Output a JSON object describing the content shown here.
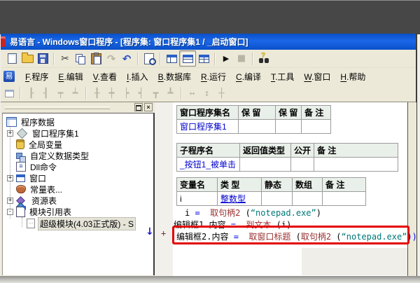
{
  "window": {
    "title": "易语言 - Windows窗口程序 - [程序集: 窗口程序集1 / _启动窗口]"
  },
  "menu": {
    "logo": "易",
    "items": [
      {
        "key": "F",
        "label": ".程序"
      },
      {
        "key": "E",
        "label": ".编辑"
      },
      {
        "key": "V",
        "label": ".查看"
      },
      {
        "key": "I",
        "label": ".插入"
      },
      {
        "key": "B",
        "label": ".数据库"
      },
      {
        "key": "R",
        "label": ".运行"
      },
      {
        "key": "C",
        "label": ".编译"
      },
      {
        "key": "T",
        "label": ".工具"
      },
      {
        "key": "W",
        "label": ".窗口"
      },
      {
        "key": "H",
        "label": ".帮助"
      }
    ]
  },
  "toolbar_main": {
    "icons": [
      "new-file",
      "open-file",
      "save",
      "cut",
      "copy",
      "paste",
      "redo",
      "undo",
      "print-preview",
      "window-layout-1",
      "window-layout-2",
      "window-layout-3",
      "run",
      "stop",
      "find-in-help"
    ],
    "help_mark": "?"
  },
  "toolbar_form": {
    "icons": [
      "form-window",
      "align-left",
      "align-right",
      "align-top",
      "align-bottom",
      "center-horizontal",
      "center-vertical",
      "space-left",
      "space-right",
      "space-top",
      "space-bottom",
      "same-width",
      "same-height",
      "same-size"
    ],
    "glyphs": [
      "┠",
      "┨",
      "┯",
      "┷",
      "╂",
      "┿",
      "┝",
      "┥",
      "┳",
      "┻",
      "↔",
      "↕",
      "┼"
    ]
  },
  "sidebar": {
    "float_button": "float-panel",
    "close_button": "×",
    "tree": [
      {
        "label": "程序数据"
      },
      {
        "label": "窗口程序集1",
        "expander": "+"
      },
      {
        "label": "全局变量"
      },
      {
        "label": "自定义数据类型"
      },
      {
        "label": "Dll命令"
      },
      {
        "label": "窗口",
        "expander": "+"
      },
      {
        "label": "常量表..."
      },
      {
        "label": "资源表",
        "expander": "+"
      },
      {
        "label": "模块引用表",
        "expander": "-"
      },
      {
        "label": "超级模块(4.03正式版) - S",
        "selected": true
      }
    ],
    "dll_icon_glyph": "≡",
    "module_icon_glyph": "…"
  },
  "editor": {
    "tables": [
      {
        "headers": [
          "窗口程序集名",
          "保 留",
          "保 留",
          "备 注"
        ],
        "rows": [
          [
            "窗口程序集1",
            "",
            "",
            ""
          ]
        ]
      },
      {
        "headers": [
          "子程序名",
          "返回值类型",
          "公开",
          "备 注"
        ],
        "rows": [
          [
            "_按钮1_被单击",
            "",
            "",
            ""
          ]
        ]
      },
      {
        "headers": [
          "变量名",
          "类 型",
          "静态",
          "数组",
          "备 注"
        ],
        "rows": [
          [
            "i",
            "整数型",
            "",
            "",
            ""
          ]
        ]
      }
    ],
    "code_lines": [
      {
        "tokens": [
          {
            "t": "i "
          },
          {
            "t": "=",
            "c": "op"
          },
          {
            "t": "  "
          },
          {
            "t": "取句柄2",
            "c": "fn"
          },
          {
            "t": " ("
          },
          {
            "t": "“notepad.exe”",
            "c": "str"
          },
          {
            "t": ")"
          }
        ]
      },
      {
        "tokens": [
          {
            "t": "编辑框1.内容 "
          },
          {
            "t": "=",
            "c": "op"
          },
          {
            "t": "  "
          },
          {
            "t": "到文本",
            "c": "fn"
          },
          {
            "t": " (i)"
          }
        ]
      },
      {
        "tokens": [
          {
            "t": "编辑框2.内容 "
          },
          {
            "t": "=",
            "c": "op"
          },
          {
            "t": "  "
          },
          {
            "t": "取窗口标题",
            "c": "fn"
          },
          {
            "t": " ("
          },
          {
            "t": "取句柄2",
            "c": "fn"
          },
          {
            "t": " ("
          },
          {
            "t": "“notepad.exe”",
            "c": "str"
          },
          {
            "t": "))",
            "c": "op"
          }
        ]
      }
    ],
    "gutter_arrow": "↓",
    "gutter_mark": "+"
  },
  "colors": {
    "titlebar_blue": "#1b67e8",
    "toolbar_beige": "#ece9d8",
    "table_header_bg": "#e9efe9",
    "identifier_blue": "#0000cc",
    "keyword_dark_red": "#9a3030",
    "string_teal": "#007878",
    "operator_blue": "#0000e6",
    "highlight_box_red": "#e30000",
    "top_band_gray": "#474747"
  }
}
